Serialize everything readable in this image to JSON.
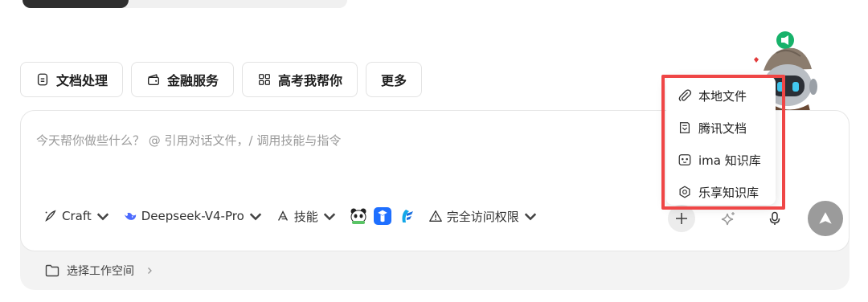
{
  "quick_chips": [
    {
      "label": "文档处理",
      "icon": "document-icon"
    },
    {
      "label": "金融服务",
      "icon": "wallet-icon"
    },
    {
      "label": "高考我帮你",
      "icon": "grid-icon"
    },
    {
      "label": "更多",
      "icon": ""
    }
  ],
  "composer": {
    "placeholder": "今天帮你做些什么？ @ 引用对话文件，/ 调用技能与指令"
  },
  "toolbar": {
    "mode": "Craft",
    "model": "Deepseek-V4-Pro",
    "skills": "技能",
    "access": "完全访问权限"
  },
  "workspace": {
    "label": "选择工作空间"
  },
  "upload_menu": {
    "items": [
      {
        "label": "本地文件",
        "icon": "paperclip-icon"
      },
      {
        "label": "腾讯文档",
        "icon": "tencent-docs-icon"
      },
      {
        "label": "ima 知识库",
        "icon": "ima-icon"
      },
      {
        "label": "乐享知识库",
        "icon": "lexiang-icon"
      }
    ]
  },
  "colors": {
    "highlight": "#ef4646",
    "send_button": "#9b9b9b",
    "mascot_badge": "#17b26a"
  }
}
